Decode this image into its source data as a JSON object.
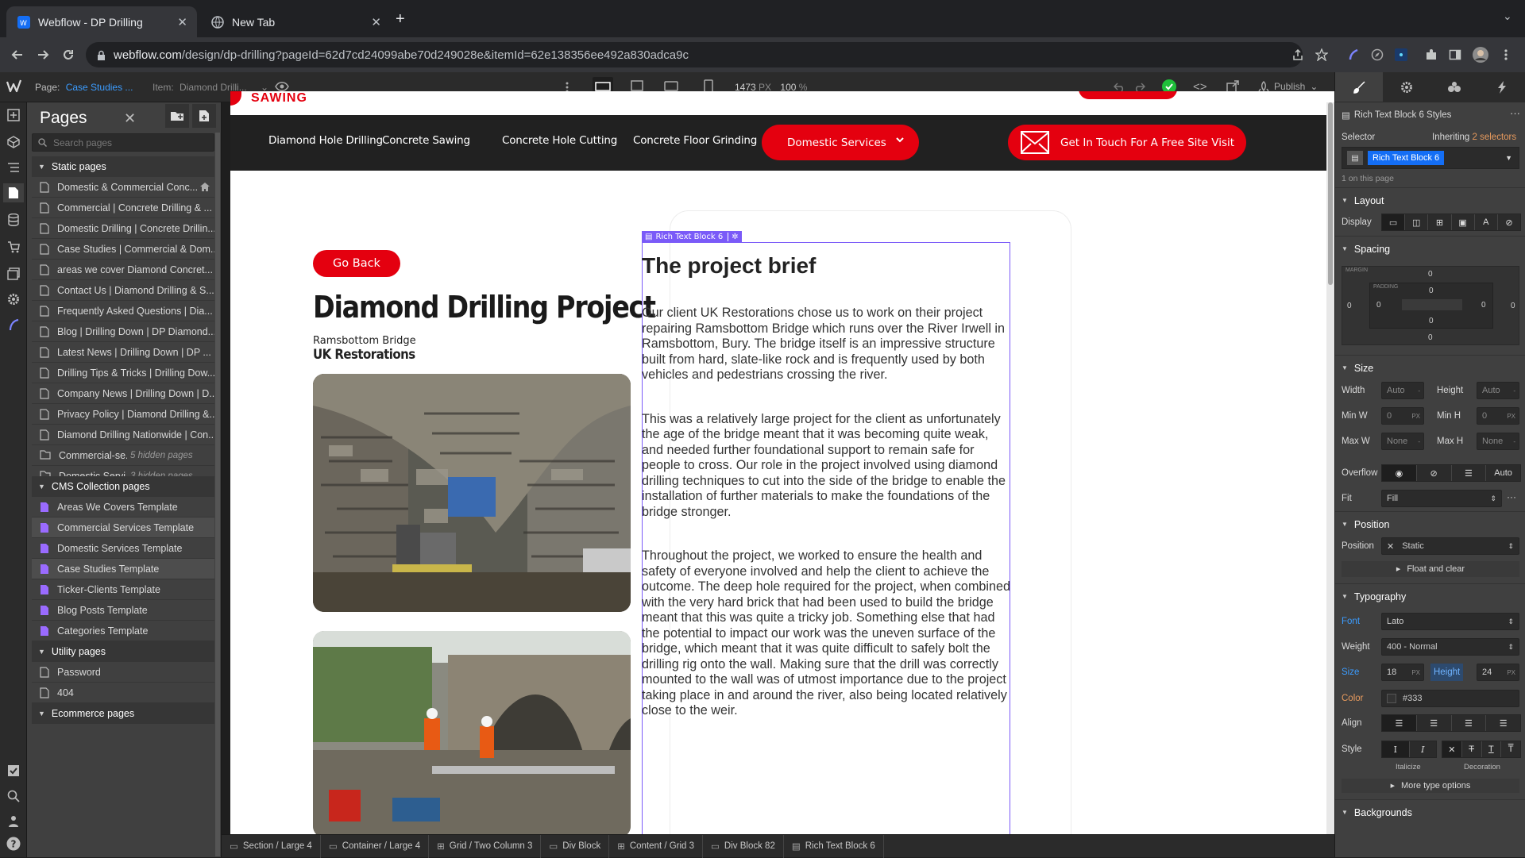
{
  "browser": {
    "tabs": [
      {
        "label": "Webflow - DP Drilling",
        "active": true
      },
      {
        "label": "New Tab",
        "active": false
      }
    ],
    "url_domain": "webflow.com",
    "url_rest": "/design/dp-drilling?pageId=62d7cd24099abe70d249028e&itemId=62e138356ee492a830adca9c"
  },
  "topbar": {
    "page_label": "Page:",
    "page_value": "Case Studies ...",
    "item_label": "Item:",
    "item_value": "Diamond Drilli...",
    "width": "1473",
    "width_unit": "PX",
    "zoom": "100",
    "zoom_unit": "%",
    "publish": "Publish"
  },
  "pages_panel": {
    "title": "Pages",
    "search_placeholder": "Search pages",
    "sections": {
      "static": "Static pages",
      "cms": "CMS Collection pages",
      "utility": "Utility pages",
      "ecommerce": "Ecommerce pages"
    },
    "static_pages": [
      "Domestic & Commercial Conc...",
      "Commercial | Concrete Drilling & ...",
      "Domestic Drilling | Concrete Drillin...",
      "Case Studies | Commercial & Dom...",
      "areas we cover Diamond Concret...",
      "Contact Us | Diamond Drilling & S...",
      "Frequently Asked Questions | Dia...",
      "Blog | Drilling Down | DP Diamond...",
      "Latest News | Drilling Down | DP ...",
      "Drilling Tips & Tricks | Drilling Dow...",
      "Company News | Drilling Down | D...",
      "Privacy Policy | Diamond Drilling &...",
      "Diamond Drilling Nationwide | Con..."
    ],
    "folders": [
      {
        "name": "Commercial-se...",
        "note": "5 hidden pages"
      },
      {
        "name": "Domestic Servi...",
        "note": "3 hidden pages"
      }
    ],
    "cms_pages": [
      "Areas We Covers Template",
      "Commercial Services Template",
      "Domestic Services Template",
      "Case Studies Template",
      "Ticker-Clients Template",
      "Blog Posts Template",
      "Categories Template"
    ],
    "utility_pages": [
      "Password",
      "404"
    ]
  },
  "site": {
    "logo_text": "SAWING",
    "nav": [
      "Diamond Hole Drilling",
      "Concrete Sawing",
      "Concrete Hole Cutting",
      "Concrete Floor Grinding"
    ],
    "nav_dropdown": "Domestic Services",
    "cta": "Get In Touch For A Free Site Visit",
    "go_back": "Go Back",
    "project_title": "Diamond Drilling Project",
    "location": "Ramsbottom Bridge",
    "client": "UK Restorations",
    "selected_tag": "Rich Text Block 6",
    "brief_heading": "The project brief",
    "paragraphs": [
      "Our client UK Restorations chose us to work on their project repairing Ramsbottom Bridge which runs over the River Irwell in Ramsbottom, Bury. The bridge itself is an impressive structure built from hard, slate-like rock and is frequently used by both vehicles and pedestrians crossing the river.",
      "This was a relatively large project for the client as unfortunately the age of the bridge meant that it was becoming quite weak, and needed further foundational support to remain safe for people to cross. Our role in the project involved using diamond drilling techniques to cut into the side of the bridge to enable the installation of further materials to make the foundations of the bridge stronger.",
      "Throughout the project, we worked to ensure the health and safety of everyone involved and help the client to achieve the outcome. The deep hole required for the project, when combined with the very hard brick that had been used to build the bridge meant that this was quite a tricky job. Something else that had the potential to impact our work was the uneven surface of the bridge, which meant that it was quite difficult to safely bolt the drilling rig onto the wall. Making sure that the drill was correctly mounted to the wall was of utmost importance due to the project taking place in and around the river, also being located relatively close to the weir."
    ]
  },
  "breadcrumbs": [
    "Section / Large 4",
    "Container / Large 4",
    "Grid / Two Column 3",
    "Div Block",
    "Content / Grid 3",
    "Div Block 82",
    "Rich Text Block 6"
  ],
  "style_panel": {
    "element_title": "Rich Text Block 6 Styles",
    "selector_label": "Selector",
    "inheriting": "Inheriting",
    "inheriting_count": "2 selectors",
    "selector_chip": "Rich Text Block 6",
    "on_page": "1 on this page",
    "layout": "Layout",
    "display": "Display",
    "spacing": "Spacing",
    "margin_label": "MARGIN",
    "padding_label": "PADDING",
    "zero": "0",
    "size": "Size",
    "width": "Width",
    "height": "Height",
    "min_w": "Min W",
    "min_h": "Min H",
    "max_w": "Max W",
    "max_h": "Max H",
    "auto": "Auto",
    "none": "None",
    "px": "PX",
    "overflow": "Overflow",
    "fit": "Fit",
    "fit_value": "Fill",
    "position": "Position",
    "position_label": "Position",
    "position_value": "Static",
    "float_clear": "Float and clear",
    "typography": "Typography",
    "font": "Font",
    "font_value": "Lato",
    "weight": "Weight",
    "weight_value": "400 - Normal",
    "size_label": "Size",
    "size_value": "18",
    "height_label": "Height",
    "height_value": "24",
    "color": "Color",
    "color_value": "#333",
    "align": "Align",
    "style": "Style",
    "italicize": "Italicize",
    "decoration": "Decoration",
    "more_type": "More type options",
    "backgrounds": "Backgrounds"
  },
  "colors": {
    "brand_red": "#e4000f",
    "webflow_blue": "#146ef5",
    "selection_purple": "#7a5af8",
    "publish_green": "#1fbf3a"
  }
}
